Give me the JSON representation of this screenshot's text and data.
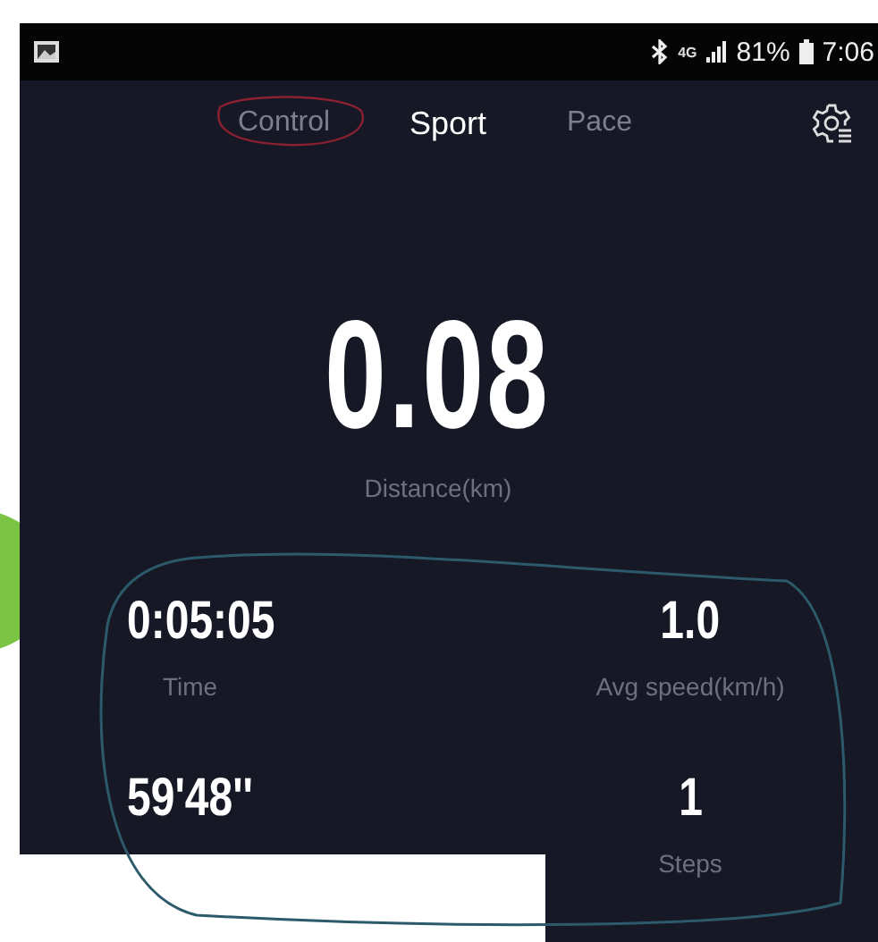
{
  "status_bar": {
    "network": "4G",
    "battery": "81%",
    "time": "7:06"
  },
  "tabs": [
    {
      "label": "Control",
      "selected": false
    },
    {
      "label": "Sport",
      "selected": true
    },
    {
      "label": "Pace",
      "selected": false
    }
  ],
  "distance": {
    "value": "0.08",
    "label": "Distance(km)"
  },
  "stats": [
    {
      "value": "0:05:05",
      "label": "Time"
    },
    {
      "value": "1.0",
      "label": "Avg speed(km/h)"
    },
    {
      "value": "59'48''"
    },
    {
      "value": "1",
      "label": "Steps"
    }
  ]
}
